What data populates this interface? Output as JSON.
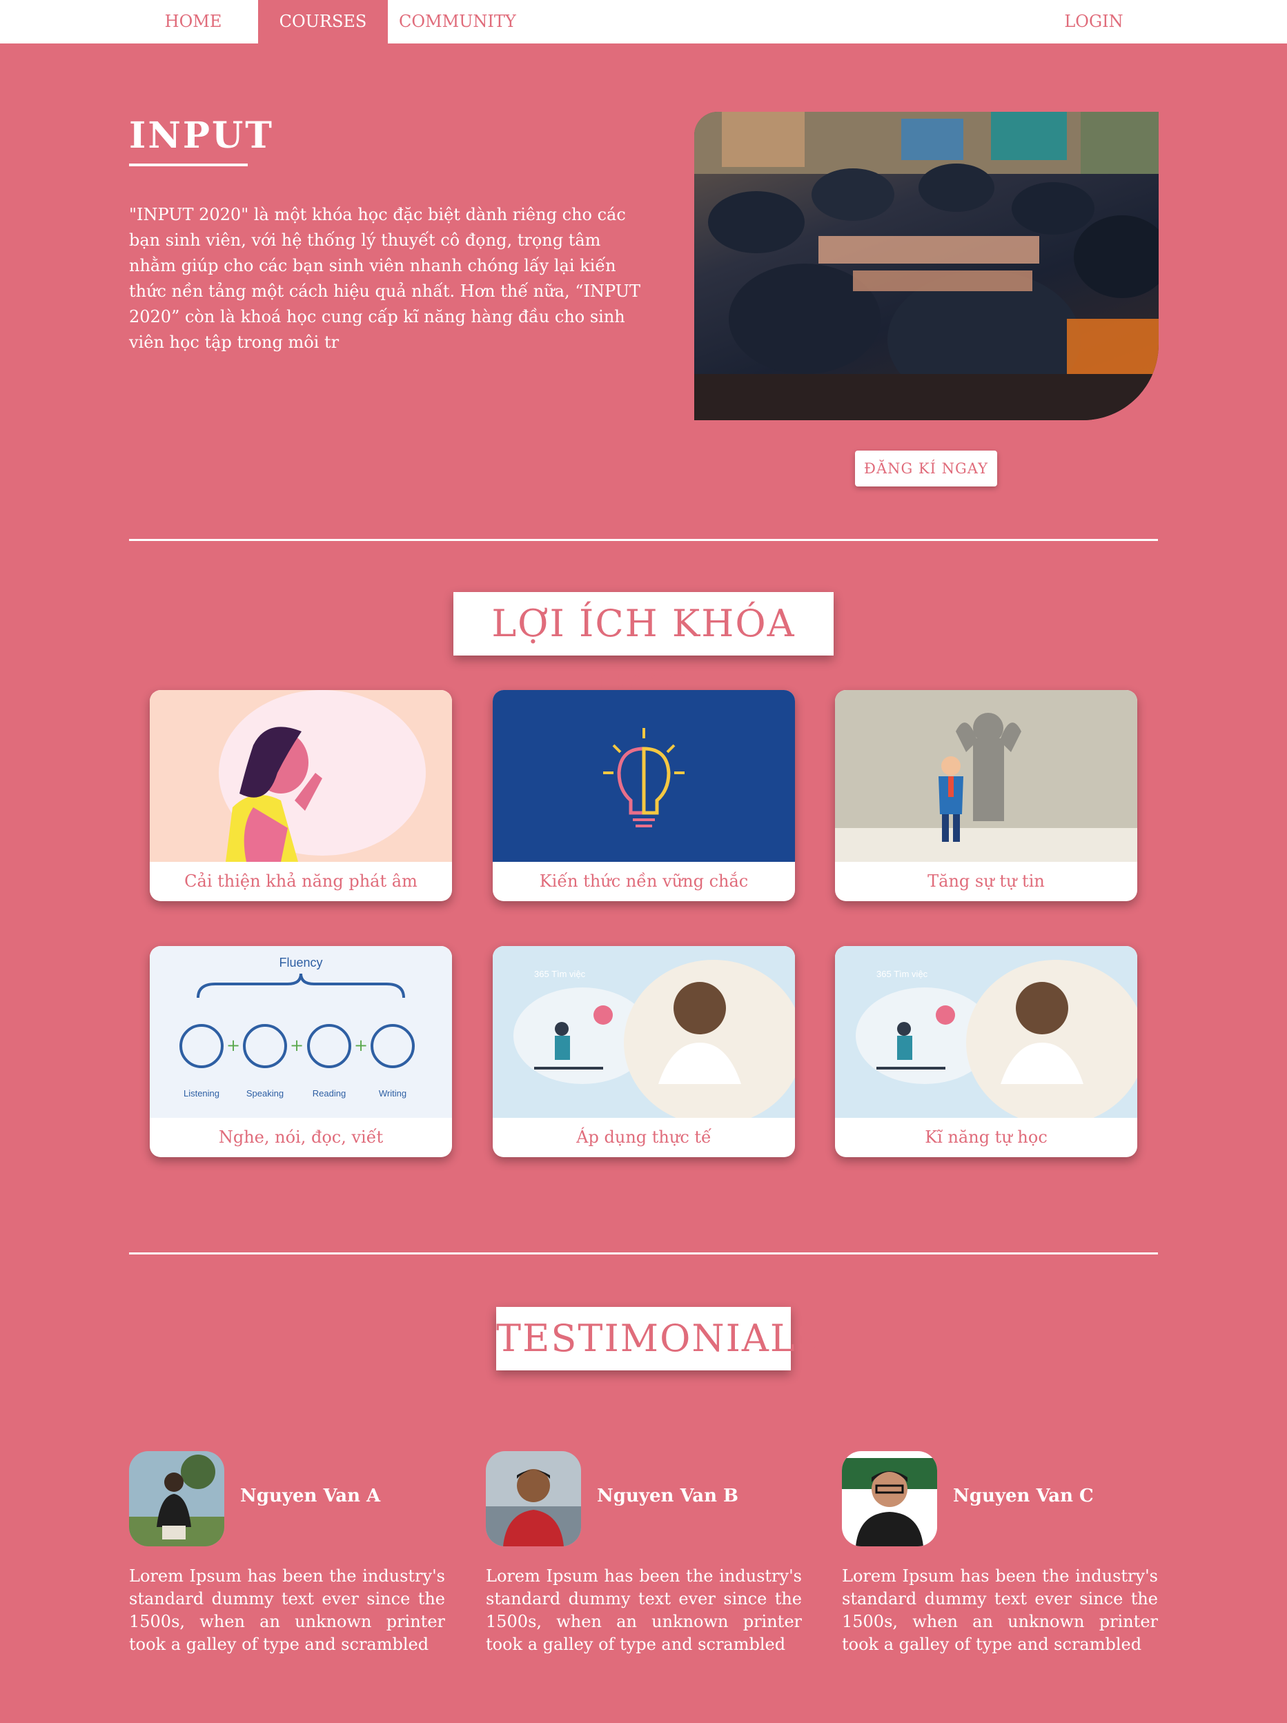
{
  "nav": {
    "home": "HOME",
    "courses": "COURSES",
    "community": "COMMUNITY",
    "login": "LOGIN"
  },
  "hero": {
    "title": "INPUT",
    "text": "\"INPUT 2020\" là một khóa học đặc biệt dành riêng cho các bạn sinh viên, với hệ thống lý thuyết cô đọng, trọng tâm nhằm giúp cho các bạn sinh viên nhanh chóng lấy lại kiến thức nền tảng một cách hiệu quả nhất. Hơn thế nữa, “INPUT 2020” còn là khoá học cung cấp kĩ năng hàng đầu cho sinh viên học tập trong môi tr",
    "register_label": "ĐĂNG KÍ NGAY"
  },
  "benefits": {
    "title": "LỢI ÍCH KHÓA HỌC",
    "cards": [
      {
        "label": "Cải thiện khả năng phát âm",
        "icon": "speaking-woman-illustration"
      },
      {
        "label": "Kiến thức nền vững chắc",
        "icon": "brain-lightbulb-icon"
      },
      {
        "label": "Tăng sự tự tin",
        "icon": "confident-man-illustration"
      },
      {
        "label": "Nghe, nói, đọc, viết",
        "icon": "fluency-skills-illustration",
        "image_text": [
          "Fluency",
          "Listening",
          "Speaking",
          "Reading",
          "Writing"
        ]
      },
      {
        "label": "Áp dụng thực tế",
        "icon": "office-worker-illustration",
        "image_text": "365 Tìm việc"
      },
      {
        "label": "Kĩ năng tự học",
        "icon": "office-worker-illustration",
        "image_text": "365 Tìm việc"
      }
    ]
  },
  "testimonials": {
    "title": "TESTIMONIALS",
    "people": [
      {
        "name": "Nguyen Van A",
        "text": "Lorem Ipsum has been the industry's standard dummy text ever since the 1500s, when an unknown printer took a galley of type and scrambled"
      },
      {
        "name": "Nguyen Van B",
        "text": "Lorem Ipsum has been the industry's standard dummy text ever since the 1500s, when an unknown printer took a galley of type and scrambled"
      },
      {
        "name": "Nguyen Van C",
        "text": "Lorem Ipsum has been the industry's standard dummy text ever since the 1500s, when an unknown printer took a galley of type and scrambled"
      }
    ]
  },
  "colors": {
    "background": "#e06c7b",
    "white": "#ffffff",
    "card_navy": "#1a4690"
  }
}
